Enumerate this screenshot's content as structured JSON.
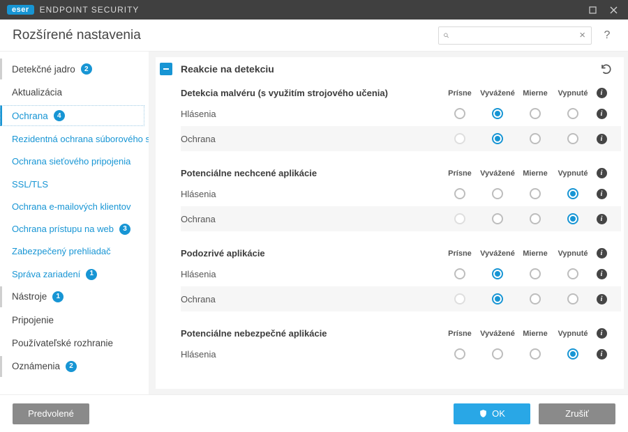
{
  "titlebar": {
    "brand": "eser",
    "product": "ENDPOINT SECURITY"
  },
  "header": {
    "page_title": "Rozšírené nastavenia",
    "search_placeholder": ""
  },
  "sidebar": {
    "items": [
      {
        "label": "Detekčné jadro",
        "badge": "2",
        "sub": false,
        "active": false,
        "marked": true
      },
      {
        "label": "Aktualizácia",
        "badge": null,
        "sub": false,
        "active": false,
        "marked": false
      },
      {
        "label": "Ochrana",
        "badge": "4",
        "sub": false,
        "active": true,
        "marked": true
      },
      {
        "label": "Rezidentná ochrana súborového systému",
        "badge": null,
        "sub": true,
        "active": false
      },
      {
        "label": "Ochrana sieťového pripojenia",
        "badge": null,
        "sub": true,
        "active": false
      },
      {
        "label": "SSL/TLS",
        "badge": null,
        "sub": true,
        "active": false
      },
      {
        "label": "Ochrana e-mailových klientov",
        "badge": null,
        "sub": true,
        "active": false
      },
      {
        "label": "Ochrana prístupu na web",
        "badge": "3",
        "sub": true,
        "active": false
      },
      {
        "label": "Zabezpečený prehliadač",
        "badge": null,
        "sub": true,
        "active": false
      },
      {
        "label": "Správa zariadení",
        "badge": "1",
        "sub": true,
        "active": false
      },
      {
        "label": "Nástroje",
        "badge": "1",
        "sub": false,
        "active": false,
        "marked": true
      },
      {
        "label": "Pripojenie",
        "badge": null,
        "sub": false,
        "active": false,
        "marked": false
      },
      {
        "label": "Používateľské rozhranie",
        "badge": null,
        "sub": false,
        "active": false,
        "marked": false
      },
      {
        "label": "Oznámenia",
        "badge": "2",
        "sub": false,
        "active": false,
        "marked": true
      }
    ]
  },
  "panel": {
    "title": "Reakcie na detekciu",
    "columns": [
      "Prísne",
      "Vyvážené",
      "Mierne",
      "Vypnuté"
    ],
    "groups": [
      {
        "title": "Detekcia malvéru (s využitím strojového učenia)",
        "rows": [
          {
            "label": "Hlásenia",
            "selected": 1,
            "dim0": false
          },
          {
            "label": "Ochrana",
            "selected": 1,
            "dim0": true
          }
        ]
      },
      {
        "title": "Potenciálne nechcené aplikácie",
        "rows": [
          {
            "label": "Hlásenia",
            "selected": 3,
            "dim0": false
          },
          {
            "label": "Ochrana",
            "selected": 3,
            "dim0": true
          }
        ]
      },
      {
        "title": "Podozrivé aplikácie",
        "rows": [
          {
            "label": "Hlásenia",
            "selected": 1,
            "dim0": false
          },
          {
            "label": "Ochrana",
            "selected": 1,
            "dim0": true
          }
        ]
      },
      {
        "title": "Potenciálne nebezpečné aplikácie",
        "rows": [
          {
            "label": "Hlásenia",
            "selected": 3,
            "dim0": false
          }
        ]
      }
    ]
  },
  "footer": {
    "defaults": "Predvolené",
    "ok": "OK",
    "cancel": "Zrušiť"
  }
}
